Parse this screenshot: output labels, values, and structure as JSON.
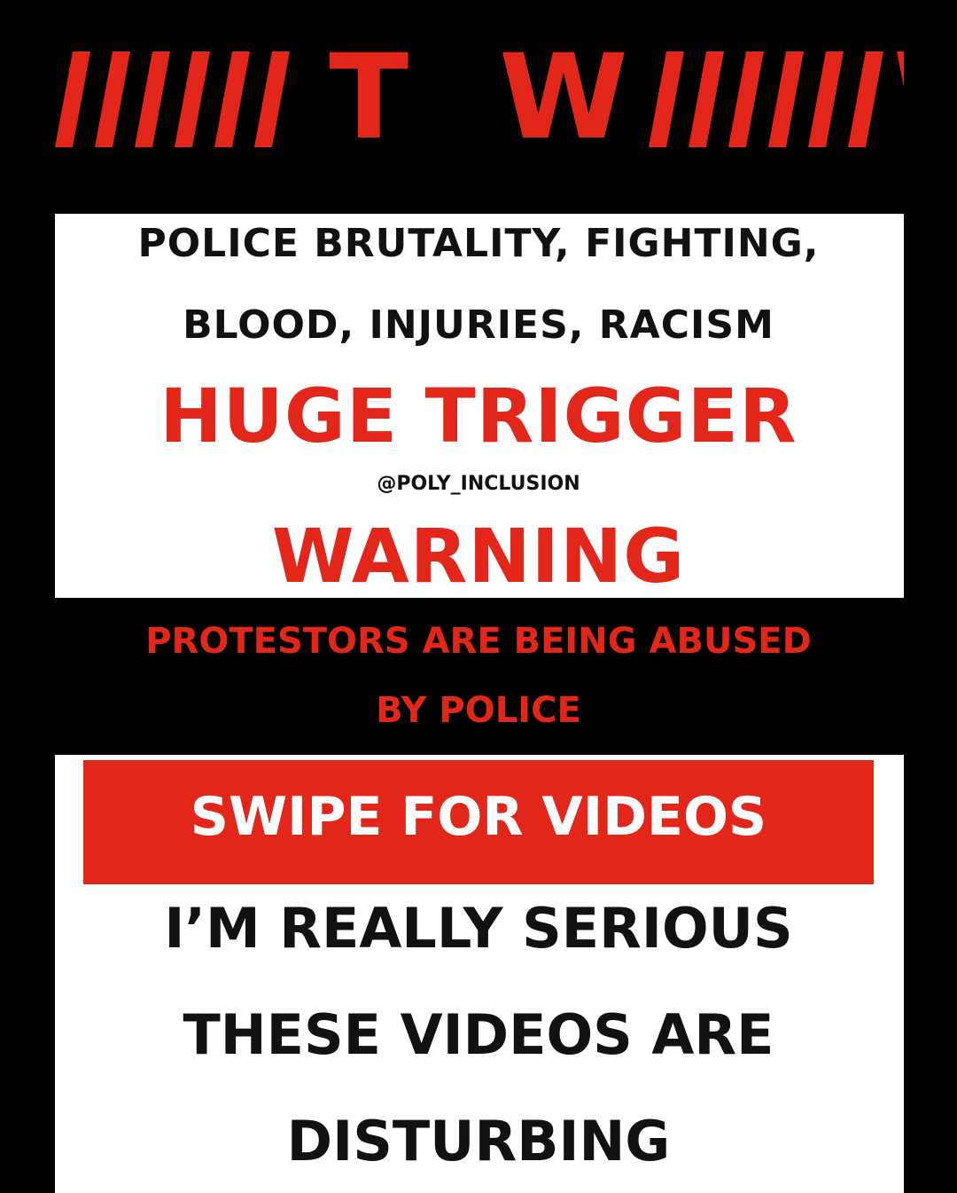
{
  "header": {
    "stripes_left": "/////",
    "title": "T W",
    "stripes_right": "/////"
  },
  "warning_panel": {
    "topics_line1": "POLICE BRUTALITY, FIGHTING,",
    "topics_line2": "BLOOD, INJURIES, RACISM",
    "headline1": "HUGE TRIGGER",
    "handle": "@POLY_INCLUSION",
    "headline2": "WARNING"
  },
  "notice": {
    "line1": "PROTESTORS ARE BEING ABUSED",
    "line2": "BY POLICE"
  },
  "cta_panel": {
    "swipe_label": "SWIPE FOR VIDEOS",
    "line1": "I’M REALLY SERIOUS",
    "line2": "THESE VIDEOS ARE",
    "line3": "DISTURBING"
  },
  "colors": {
    "accent_red": "#e2271a",
    "background": "#000000",
    "panel": "#ffffff"
  }
}
